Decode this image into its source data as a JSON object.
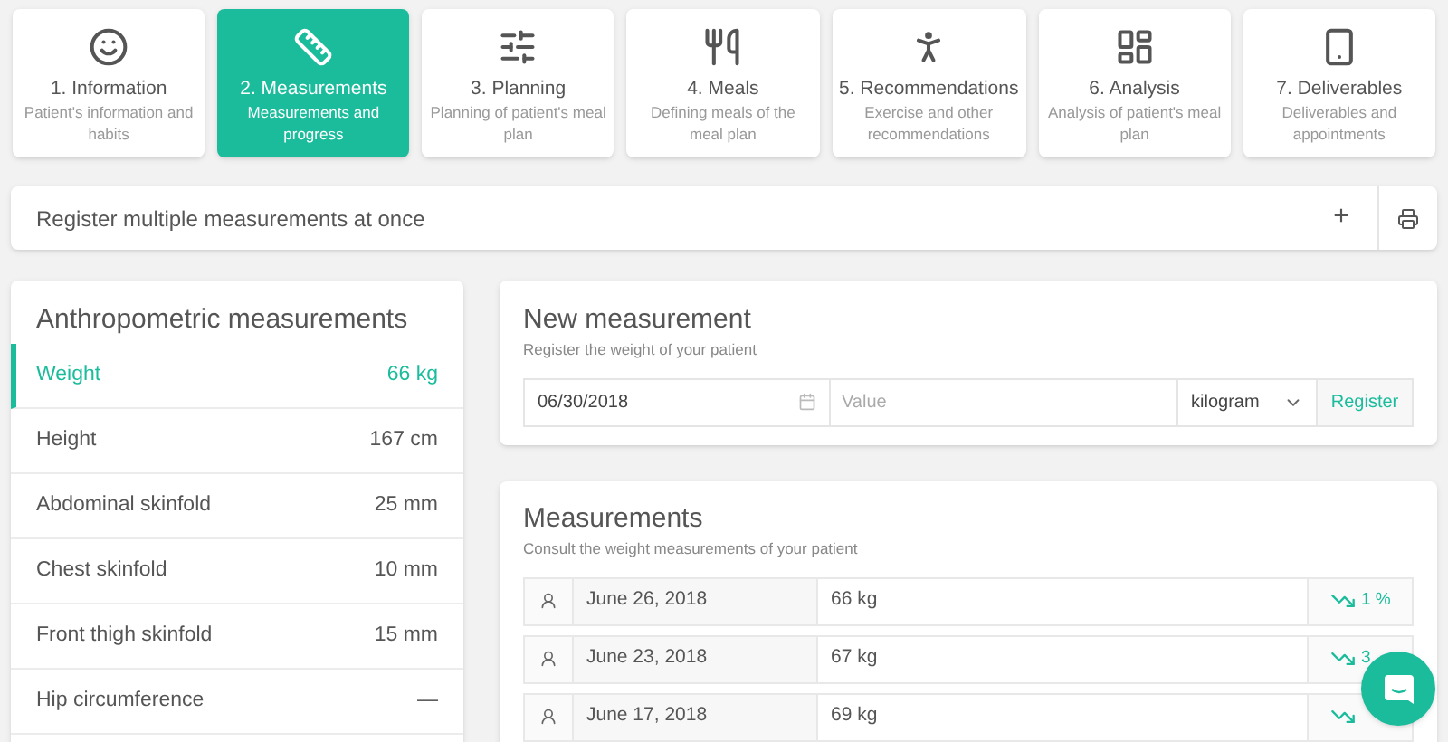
{
  "steps": [
    {
      "title": "1. Information",
      "subtitle": "Patient's information and habits",
      "selected": false
    },
    {
      "title": "2. Measurements",
      "subtitle": "Measurements and progress",
      "selected": true
    },
    {
      "title": "3. Planning",
      "subtitle": "Planning of patient's meal plan",
      "selected": false
    },
    {
      "title": "4. Meals",
      "subtitle": "Defining meals of the meal plan",
      "selected": false
    },
    {
      "title": "5. Recommendations",
      "subtitle": "Exercise and other recommendations",
      "selected": false
    },
    {
      "title": "6. Analysis",
      "subtitle": "Analysis of patient's meal plan",
      "selected": false
    },
    {
      "title": "7. Deliverables",
      "subtitle": "Deliverables and appointments",
      "selected": false
    }
  ],
  "bulk_bar": {
    "label": "Register multiple measurements at once",
    "add": "+"
  },
  "anthropometric": {
    "title": "Anthropometric measurements",
    "items": [
      {
        "name": "Weight",
        "value": "66 kg",
        "selected": true
      },
      {
        "name": "Height",
        "value": "167 cm",
        "selected": false
      },
      {
        "name": "Abdominal skinfold",
        "value": "25 mm",
        "selected": false
      },
      {
        "name": "Chest skinfold",
        "value": "10 mm",
        "selected": false
      },
      {
        "name": "Front thigh skinfold",
        "value": "15 mm",
        "selected": false
      },
      {
        "name": "Hip circumference",
        "value": "—",
        "selected": false
      }
    ]
  },
  "new_measurement": {
    "title": "New measurement",
    "subtitle": "Register the weight of your patient",
    "date": "06/30/2018",
    "value_placeholder": "Value",
    "unit": "kilogram",
    "register": "Register"
  },
  "measurements": {
    "title": "Measurements",
    "subtitle": "Consult the weight measurements of your patient",
    "rows": [
      {
        "date": "June 26, 2018",
        "value": "66 kg",
        "kind": "decrease",
        "change": "1 %"
      },
      {
        "date": "June 23, 2018",
        "value": "67 kg",
        "kind": "decrease",
        "change": "3"
      },
      {
        "date": "June 17, 2018",
        "value": "69 kg",
        "kind": "decrease"
      }
    ]
  }
}
